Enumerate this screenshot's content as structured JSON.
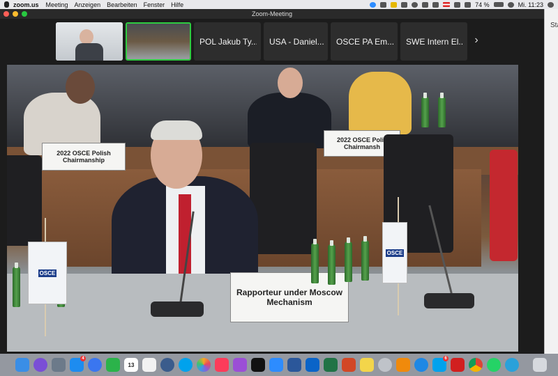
{
  "menubar": {
    "app_name": "zoom.us",
    "menus": [
      "Meeting",
      "Anzeigen",
      "Bearbeiten",
      "Fenster",
      "Hilfe"
    ],
    "battery": "74 %",
    "clock": "Mi. 11:23"
  },
  "window": {
    "title": "Zoom-Meeting"
  },
  "thumbnails": [
    {
      "type": "video",
      "name": ""
    },
    {
      "type": "video",
      "name": "",
      "active": true
    },
    {
      "type": "name",
      "name": "POL Jakub Ty..."
    },
    {
      "type": "name",
      "name": "USA - Daniel..."
    },
    {
      "type": "name",
      "name": "OSCE PA Em..."
    },
    {
      "type": "name",
      "name": "SWE Intern El..."
    }
  ],
  "video": {
    "nameplates": {
      "speaker": [
        "Rapporteur under Moscow",
        "Mechanism"
      ],
      "left": [
        "2022 OSCE Polish",
        "Chairmanship"
      ],
      "right": [
        "2022 OSCE Polis",
        "Chairmansh"
      ]
    },
    "flag_text": "OSCE"
  },
  "side_window": {
    "label": "Sta"
  },
  "dock": {
    "badges": {
      "appstore": "4",
      "calendar": "13",
      "skype": "6"
    }
  },
  "colors": {
    "active_border": "#2ecc40",
    "tile_bg": "#2d2d2d",
    "window_bg": "#1c1c1c"
  }
}
